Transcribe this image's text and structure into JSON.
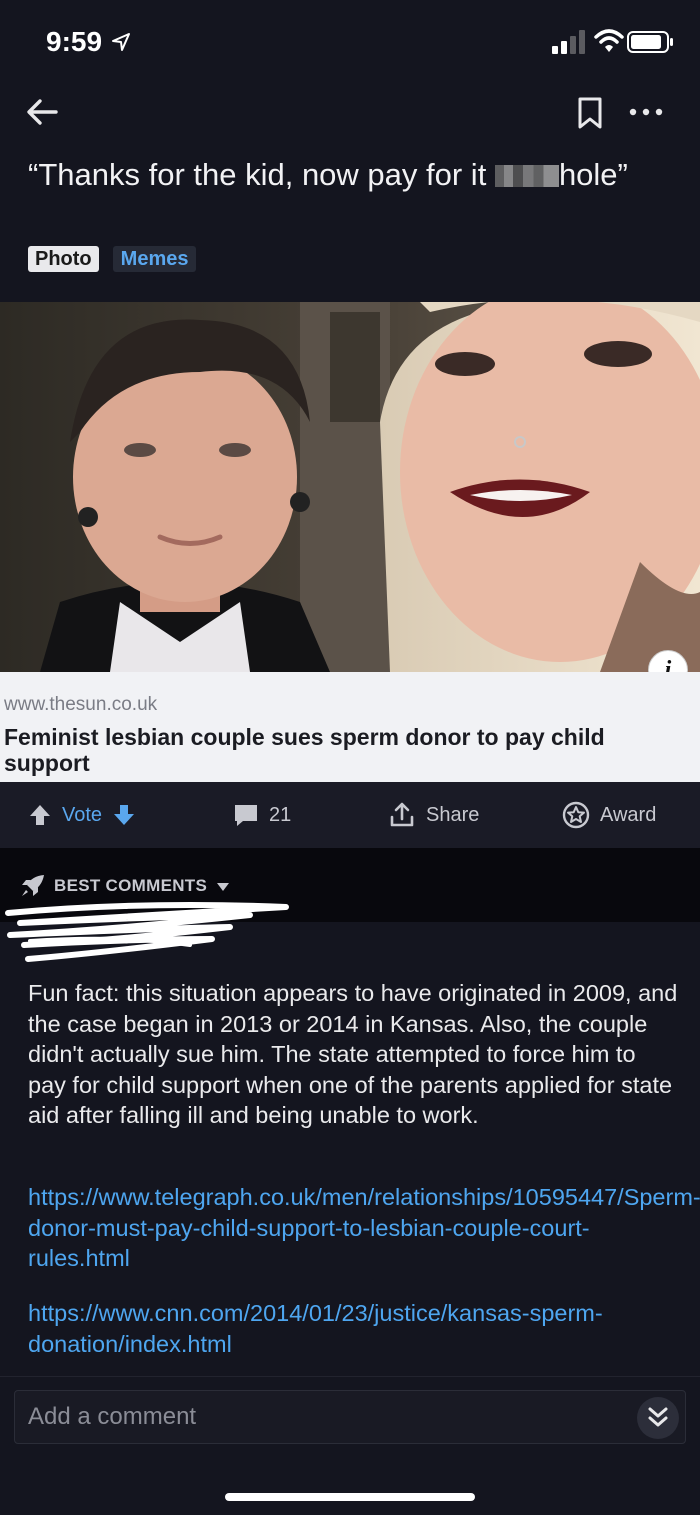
{
  "status_bar": {
    "time": "9:59"
  },
  "post": {
    "title_prefix": "“Thanks for the kid, now pay for it ",
    "title_suffix": "hole”",
    "flair_type": "Photo",
    "flair_tag": "Memes"
  },
  "link_card": {
    "domain": "www.thesun.co.uk",
    "headline": "Feminist lesbian couple sues sperm donor to pay child support"
  },
  "actions": {
    "vote_label": "Vote",
    "comment_count": "21",
    "share_label": "Share",
    "award_label": "Award"
  },
  "comments_header": {
    "sort_label": "BEST COMMENTS"
  },
  "comment": {
    "body": "Fun fact: this situation appears to have originated in 2009, and the case began in 2013 or 2014 in Kansas. Also, the couple didn't actually sue him. The state attempted to force him to pay for child support when one of the parents applied for state aid after falling ill and being unable to work.",
    "link_1": "https://www.telegraph.co.uk/men/relationships/10595447/Sperm-donor-must-pay-child-support-to-lesbian-couple-court-rules.html",
    "link_2": "https://www.cnn.com/2014/01/23/justice/kansas-sperm-donation/index.html"
  },
  "composer": {
    "placeholder": "Add a comment"
  },
  "colors": {
    "background": "#14151f",
    "accent_blue": "#5aa7ee",
    "link_blue": "#4ea6f0",
    "card_bg": "#f1f2f5"
  },
  "icons": [
    "location-arrow-icon",
    "signal-icon",
    "wifi-icon",
    "battery-icon",
    "back-arrow-icon",
    "bookmark-icon",
    "more-icon",
    "info-icon",
    "upvote-icon",
    "downvote-icon",
    "comment-icon",
    "share-icon",
    "award-icon",
    "rocket-icon",
    "caret-down-icon",
    "double-chevron-down-icon"
  ]
}
